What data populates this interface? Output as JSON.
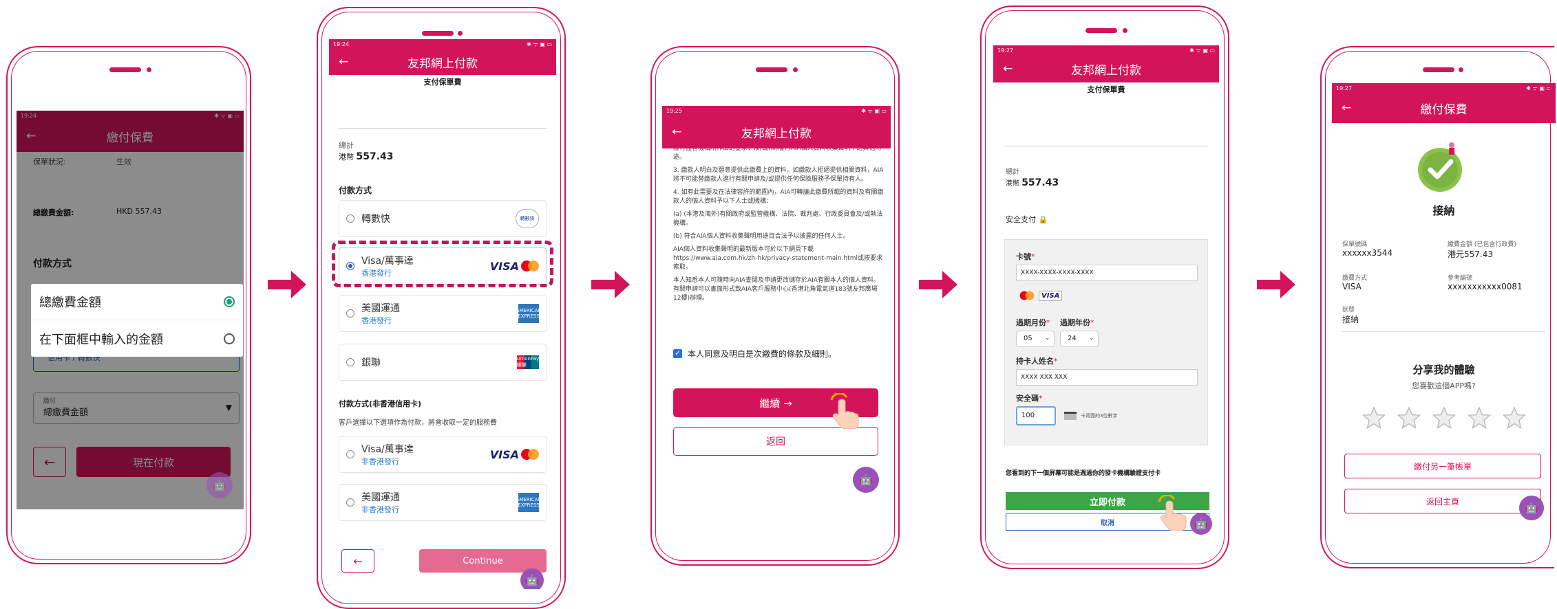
{
  "p1": {
    "time": "19:24",
    "status_icons": "✱ ᯤ ▣ ▭",
    "title": "繳付保費",
    "back": "←",
    "policy_status_label": "保單狀況:",
    "policy_status_value": "生效",
    "total_label": "總繳費金額:",
    "total_value": "HKD 557.43",
    "payment_method": "付款方式",
    "dropdown_options": [
      "總繳費金額",
      "在下面框中輸入的金額"
    ],
    "credit_card_hint": "信用卡 / 轉數快",
    "amount_select_label": "繳付",
    "amount_select_value": "總繳費金額",
    "back_btn": "←",
    "pay_now": "現在付款",
    "bot": "🤖"
  },
  "p2": {
    "time": "19:24",
    "status_icons": "✱ ᯤ ▣ ▭",
    "title": "友邦網上付款",
    "back": "←",
    "subtitle": "支付保單費",
    "total_label": "總計",
    "currency": "港幣",
    "amount": "557.43",
    "method_heading": "付款方式",
    "options": [
      {
        "name": "轉數快",
        "sub": ""
      },
      {
        "name": "Visa/萬事達",
        "sub": "香港發行"
      },
      {
        "name": "美國運通",
        "sub": "香港發行"
      },
      {
        "name": "銀聯",
        "sub": ""
      }
    ],
    "nonhk_heading": "付款方式(非香港信用卡)",
    "nonhk_note": "客戶選擇以下選項作為付款，將會收取一定的服務費",
    "nonhk_options": [
      {
        "name": "Visa/萬事達",
        "sub": "非香港發行"
      },
      {
        "name": "美國運通",
        "sub": "非香港發行"
      }
    ],
    "visa_text": "VISA",
    "amex_text": "AMERICAN EXPRESS",
    "unionpay_text": "UnionPay 銀聯",
    "fps_text": "轉數快",
    "back_btn": "←",
    "continue": "Continue",
    "bot": "🤖"
  },
  "p3": {
    "time": "19:25",
    "status_icons": "✱ ᯤ ▣ ▭",
    "title": "友邦網上付款",
    "back": "←",
    "terms": [
      "履行監管機構所作出的要求；及/或(iii)履行AIA個人資料收集聲明中的其他用途。",
      "3. 繳款人明白及願意提供此繳費上的資料，如繳款人拒絕提供相關資料，AIA將不可能替繳款人進行有關申請及/或提供任何保險服務予保單持有人。",
      "4. 如有此需要及在法律容許的範圍內，AIA可轉讓此繳費所載的資料及有關繳款人的個人資料予以下人士或機構：",
      "(a) (本港及海外)有關政府或監管機構、法院、裁判處、行政委員會及/或執法機構。",
      "(b) 符合AIA個人資料收集聲明用途目合法予以披露的任何人士。",
      "AIA個人資料收集聲明的最新版本可於以下網頁下載 https://www.aia.com.hk/zh-hk/privacy-statement-main.html或按要求索取。",
      "本人知悉本人可隨時向AIA查閱及申請更改儲存於AIA有關本人的個人資料。有關申請可以書面形式致AIA客戶服務中心(香港北角電氣道183號友邦廣場12樓)辦理。"
    ],
    "agree": "本人同意及明白是次繳費的條款及細則。",
    "continue": "繼續 →",
    "return": "返回",
    "bot": "🤖"
  },
  "p4": {
    "time": "19:27",
    "status_icons": "✱ ᯤ ▣ ▭",
    "title": "友邦網上付款",
    "back": "←",
    "subtitle": "支付保單費",
    "total_label": "總計",
    "currency": "港幣",
    "amount": "557.43",
    "secure": "安全支付",
    "card_no_label": "卡號",
    "card_no_placeholder": "XXXX-XXXX-XXXX-XXXX",
    "exp_month_label": "過期月份",
    "exp_year_label": "過期年份",
    "exp_month": "05",
    "exp_year": "24",
    "holder_label": "持卡人姓名",
    "holder_value": "XXXX XXX XXX",
    "cvv_label": "安全碼",
    "cvv_value": "100",
    "cvv_hint": "卡背面的3位數字",
    "notice": "您看到的下一個屏幕可能是週過你的發卡機構驗證支付卡",
    "pay_now": "立即付款",
    "cancel": "取消",
    "required": "*",
    "visa_text": "VISA",
    "bot": "🤖"
  },
  "p5": {
    "time": "19:27",
    "status_icons": "✱ ᯤ ▣ ▭",
    "title": "繳付保費",
    "back": "←",
    "accepted": "接納",
    "policy_no_label": "保單號碼",
    "policy_no": "xxxxxx3544",
    "paid_label": "繳費金額 (已包含行政費)",
    "paid_value": "港元557.43",
    "method_label": "繳費方式",
    "method_value": "VISA",
    "ref_label": "參考編號",
    "ref_value": "xxxxxxxxxxx0081",
    "status_label": "狀態",
    "status_value": "接納",
    "share_title": "分享我的體驗",
    "share_q": "您喜歡這個APP嗎?",
    "rating": 0,
    "pay_another": "繳付另一筆帳單",
    "home": "返回主頁",
    "bot": "🤖"
  },
  "colors": {
    "brand": "#d4145a",
    "green": "#3ca546",
    "blue": "#2b5fc4"
  }
}
